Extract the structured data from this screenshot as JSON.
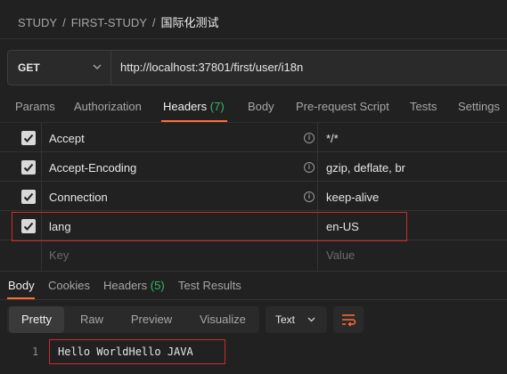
{
  "breadcrumb": {
    "items": [
      "STUDY",
      "FIRST-STUDY"
    ],
    "current": "国际化测试",
    "separator": "/"
  },
  "request": {
    "method": "GET",
    "url": "http://localhost:37801/first/user/i18n"
  },
  "tabs": {
    "params": "Params",
    "authorization": "Authorization",
    "headers": "Headers",
    "headers_count": "(7)",
    "body": "Body",
    "pre_request": "Pre-request Script",
    "tests": "Tests",
    "settings": "Settings"
  },
  "headers_table": {
    "rows": [
      {
        "key": "Accept",
        "value": "*/*",
        "checked": true
      },
      {
        "key": "Accept-Encoding",
        "value": "gzip, deflate, br",
        "checked": true
      },
      {
        "key": "Connection",
        "value": "keep-alive",
        "checked": true
      },
      {
        "key": "lang",
        "value": "en-US",
        "checked": true
      }
    ],
    "key_placeholder": "Key",
    "value_placeholder": "Value",
    "info_glyph": "i"
  },
  "response": {
    "tabs": {
      "body": "Body",
      "cookies": "Cookies",
      "headers": "Headers",
      "headers_count": "(5)",
      "test_results": "Test Results"
    },
    "view_modes": [
      "Pretty",
      "Raw",
      "Preview",
      "Visualize"
    ],
    "format": "Text",
    "lines": [
      {
        "number": "1",
        "text": "Hello WorldHello JAVA"
      }
    ]
  },
  "colors": {
    "accent": "#ff6c37",
    "count": "#35b86a",
    "highlight": "#d0282e",
    "background": "#212121"
  }
}
